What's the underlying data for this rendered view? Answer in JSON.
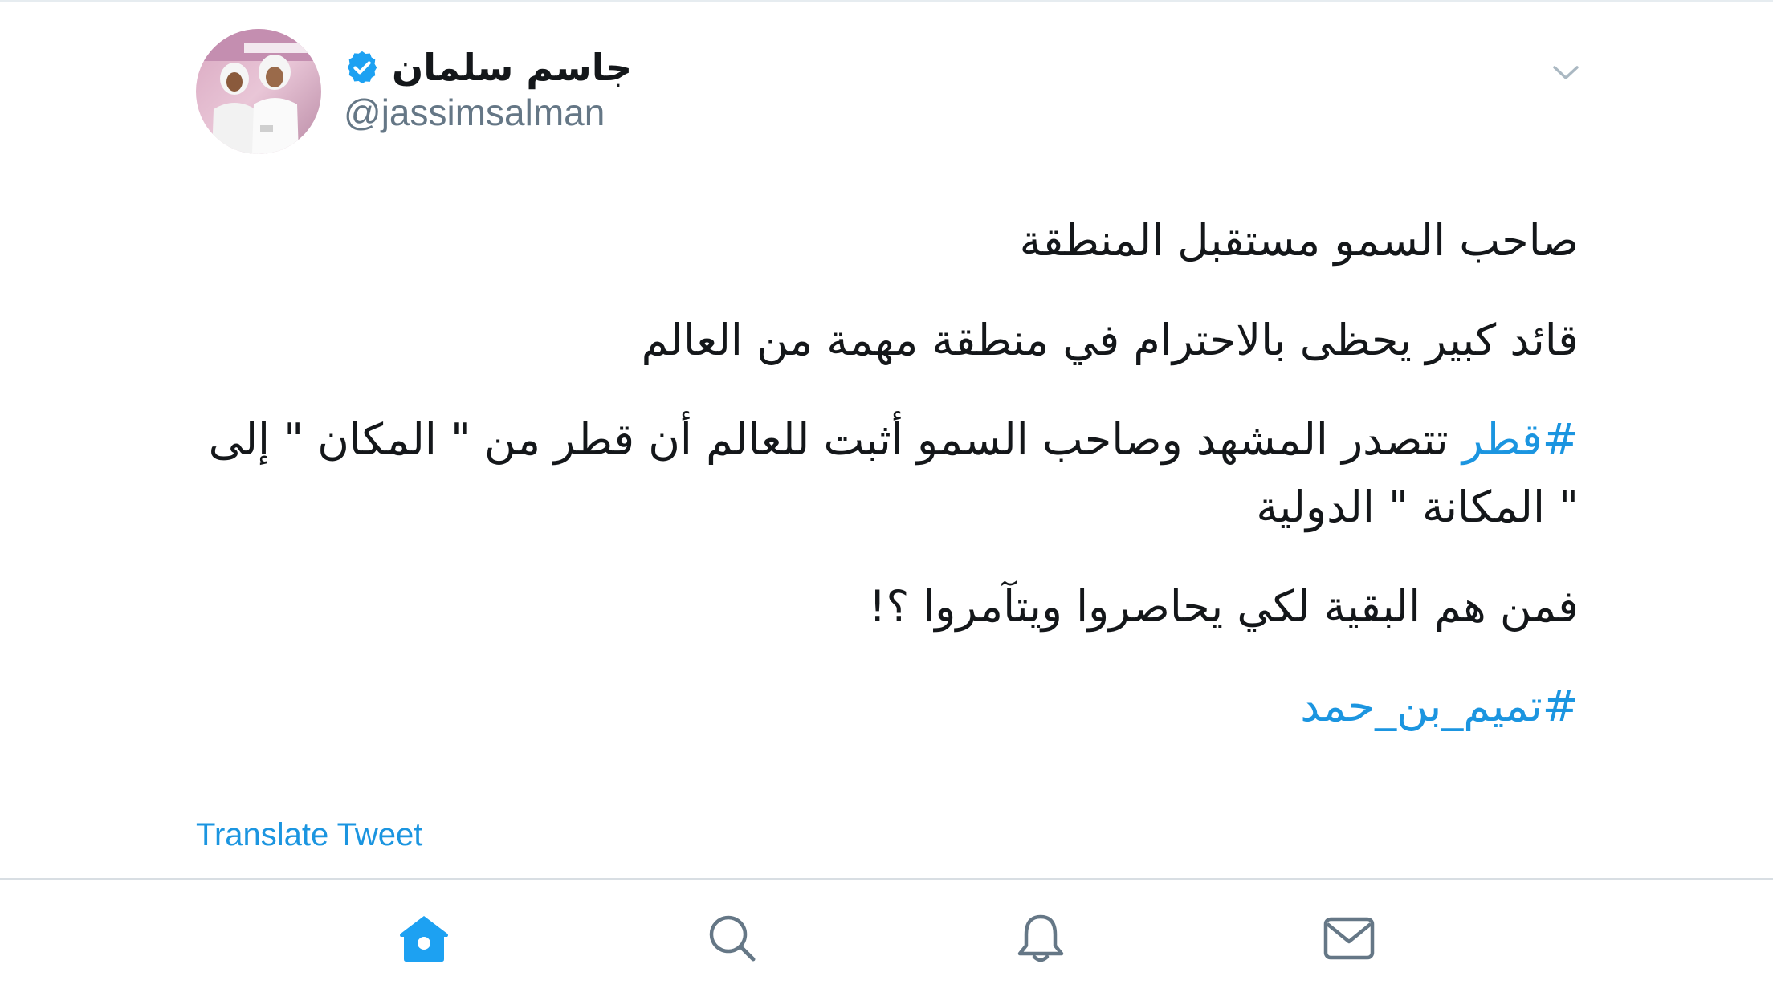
{
  "tweet": {
    "author": {
      "name": "جاسم سلمان",
      "handle": "@jassimsalman",
      "verified": true
    },
    "paragraphs": [
      {
        "text": "صاحب السمو مستقبل المنطقة"
      },
      {
        "text": "قائد كبير  يحظى بالاحترام في  منطقة مهمة  من العالم"
      },
      {
        "hashtag": "#قطر",
        "text": " تتصدر المشهد وصاحب السمو أثبت للعالم أن قطر من \" المكان \"  إلى \" المكانة \" الدولية"
      },
      {
        "text": "فمن هم البقية لكي يحاصروا ويتآمروا ؟!"
      },
      {
        "hashtag": "#تميم_بن_حمد"
      }
    ],
    "translate_label": "Translate Tweet"
  },
  "tab_bar": {
    "items": [
      {
        "icon": "home-icon",
        "active": true
      },
      {
        "icon": "search-icon",
        "active": false
      },
      {
        "icon": "bell-icon",
        "active": false
      },
      {
        "icon": "mail-icon",
        "active": false
      }
    ]
  },
  "colors": {
    "accent": "#1da1f2",
    "link": "#1b95e0",
    "text": "#14171a",
    "secondary": "#657786",
    "icon": "#657786"
  }
}
